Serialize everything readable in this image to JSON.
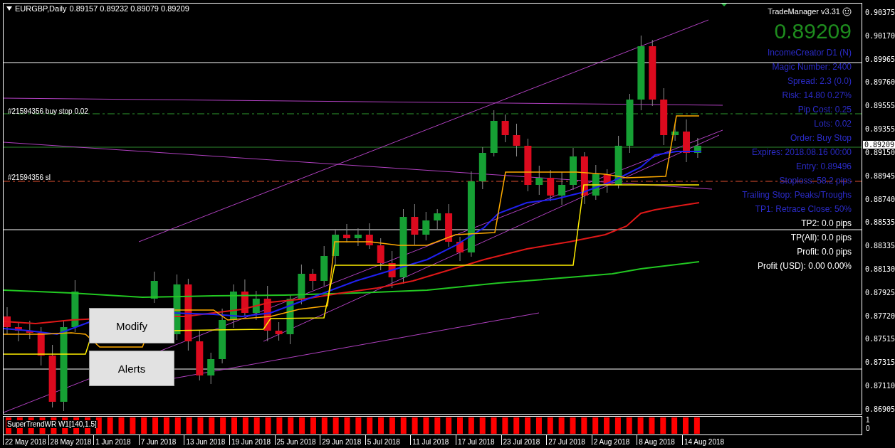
{
  "chart": {
    "symbol": "EURGBP,Daily",
    "quote": "0.89157 0.89232 0.89079 0.89209"
  },
  "order_labels": [
    {
      "text": "#21594356 buy stop 0.02",
      "kind": "entry"
    },
    {
      "text": "#21594356 sl",
      "kind": "stop"
    }
  ],
  "buttons": [
    "Modify",
    "Alerts"
  ],
  "trade_manager": {
    "title": "TradeManager v3.31",
    "price": "0.89209",
    "lines": [
      {
        "text": "IncomeCreator D1 (N)",
        "color": "#2b2bc8"
      },
      {
        "text": "Magic Number: 2400",
        "color": "#2b2bc8"
      },
      {
        "text": "Spread: 2.3 (0.0)",
        "color": "#2b2bc8"
      },
      {
        "text": "Risk: 14.80 0.27%",
        "color": "#2b2bc8"
      },
      {
        "text": "Pip Cost: 0.25",
        "color": "#2b2bc8"
      },
      {
        "text": "Lots: 0.02",
        "color": "#2b2bc8"
      },
      {
        "text": "Order: Buy Stop",
        "color": "#2b2bc8"
      },
      {
        "text": "Expires: 2018.08.16 00:00",
        "color": "#2b2bc8"
      },
      {
        "text": "Entry: 0.89496",
        "color": "#2b2bc8"
      },
      {
        "text": "Stoploss: 58.2 pips",
        "color": "#2b2bc8"
      },
      {
        "text": "Trailing Stop: Peaks/Troughs",
        "color": "#2b2bc8"
      },
      {
        "text": "TP1: Retrace Close: 50%",
        "color": "#2b2bc8"
      },
      {
        "text": "TP2: 0.0 pips",
        "color": "#ffffff"
      },
      {
        "text": "TP(All): 0.0 pips",
        "color": "#ffffff"
      },
      {
        "text": "Profit: 0.0 pips",
        "color": "#ffffff"
      },
      {
        "text": "Profit (USD): 0.00 0.00%",
        "color": "#ffffff"
      }
    ]
  },
  "price_axis": {
    "ticks": [
      "0.90375",
      "0.90170",
      "0.89965",
      "0.89760",
      "0.89555",
      "0.89355",
      "0.89150",
      "0.88945",
      "0.88740",
      "0.88535",
      "0.88335",
      "0.88130",
      "0.87925",
      "0.87720",
      "0.87515",
      "0.87315",
      "0.87110",
      "0.86905"
    ],
    "current": "0.89209"
  },
  "indicator": {
    "label": "SuperTrendWR W1[140,1.5]",
    "scale": [
      "1",
      "0"
    ]
  },
  "date_axis": [
    "22 May 2018",
    "28 May 2018",
    "1 Jun 2018",
    "7 Jun 2018",
    "13 Jun 2018",
    "19 Jun 2018",
    "25 Jun 2018",
    "29 Jun 2018",
    "5 Jul 2018",
    "11 Jul 2018",
    "17 Jul 2018",
    "23 Jul 2018",
    "27 Jul 2018",
    "2 Aug 2018",
    "8 Aug 2018",
    "14 Aug 2018"
  ]
}
